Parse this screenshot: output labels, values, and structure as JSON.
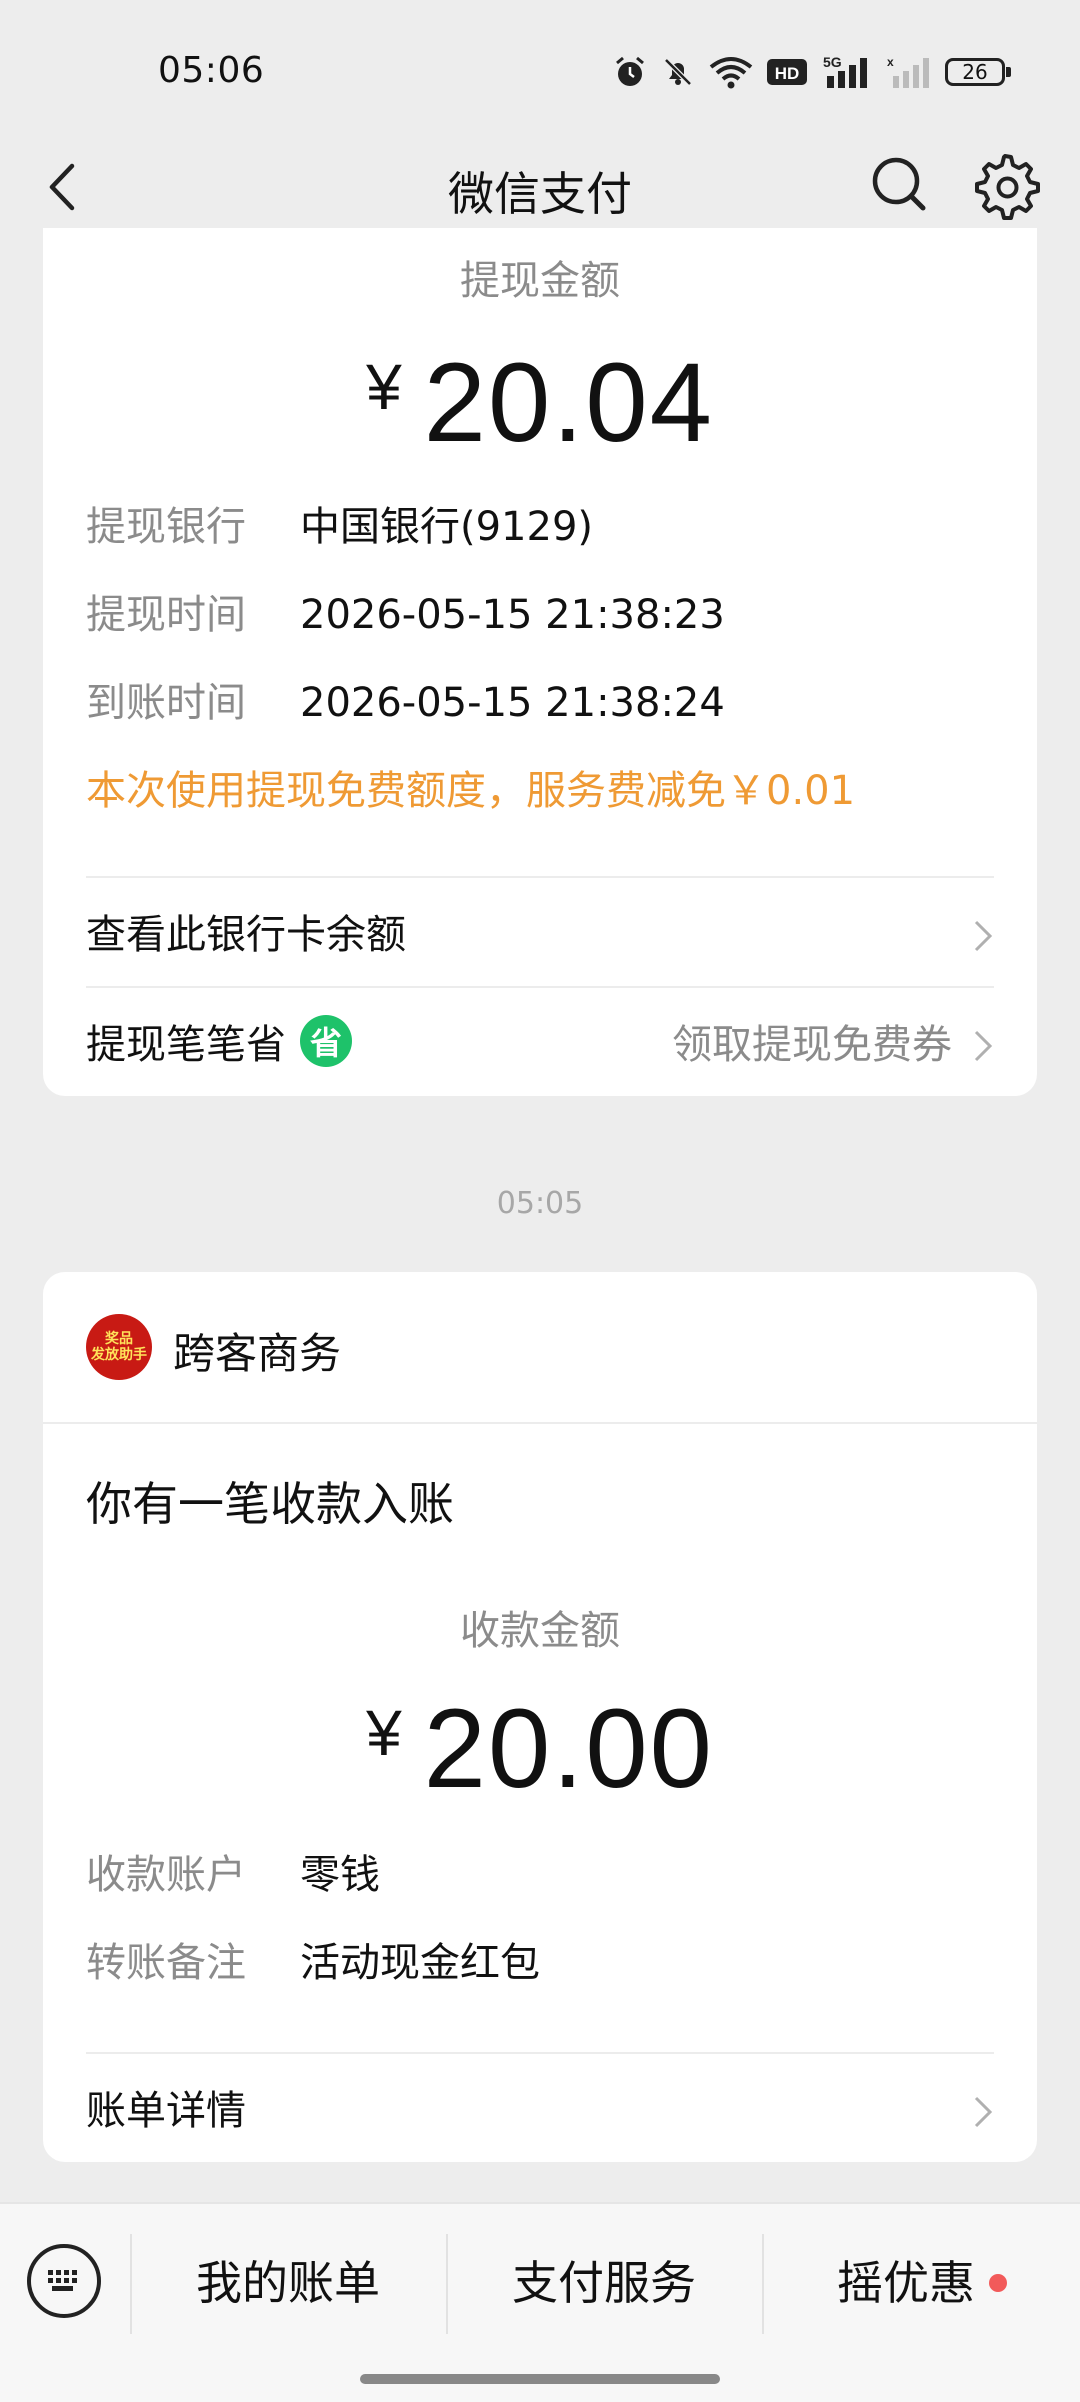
{
  "status_bar": {
    "time": "05:06",
    "battery": "26",
    "network": "5G",
    "hd_label": "HD"
  },
  "nav": {
    "title": "微信支付"
  },
  "withdraw_card": {
    "amount_label": "提现金额",
    "currency": "¥",
    "amount": "20.04",
    "rows": [
      {
        "key": "提现银行",
        "value": "中国银行(9129)"
      },
      {
        "key": "提现时间",
        "value": "2026-05-15 21:38:23"
      },
      {
        "key": "到账时间",
        "value": "2026-05-15 21:38:24"
      }
    ],
    "fee_notice": "本次使用提现免费额度，服务费减免￥0.01",
    "link_balance": "查看此银行卡余额",
    "link_save": "提现笔笔省",
    "save_badge": "省",
    "link_coupon": "领取提现免费券"
  },
  "timestamp": "05:05",
  "receipt_card": {
    "merchant_name": "跨客商务",
    "merchant_logo_lines": [
      "奖品",
      "发放助手"
    ],
    "notice": "你有一笔收款入账",
    "amount_label": "收款金额",
    "currency": "¥",
    "amount": "20.00",
    "rows": [
      {
        "key": "收款账户",
        "value": "零钱"
      },
      {
        "key": "转账备注",
        "value": "活动现金红包"
      }
    ],
    "link_details": "账单详情"
  },
  "bottom_bar": {
    "tabs": [
      "我的账单",
      "支付服务",
      "摇优惠"
    ]
  }
}
